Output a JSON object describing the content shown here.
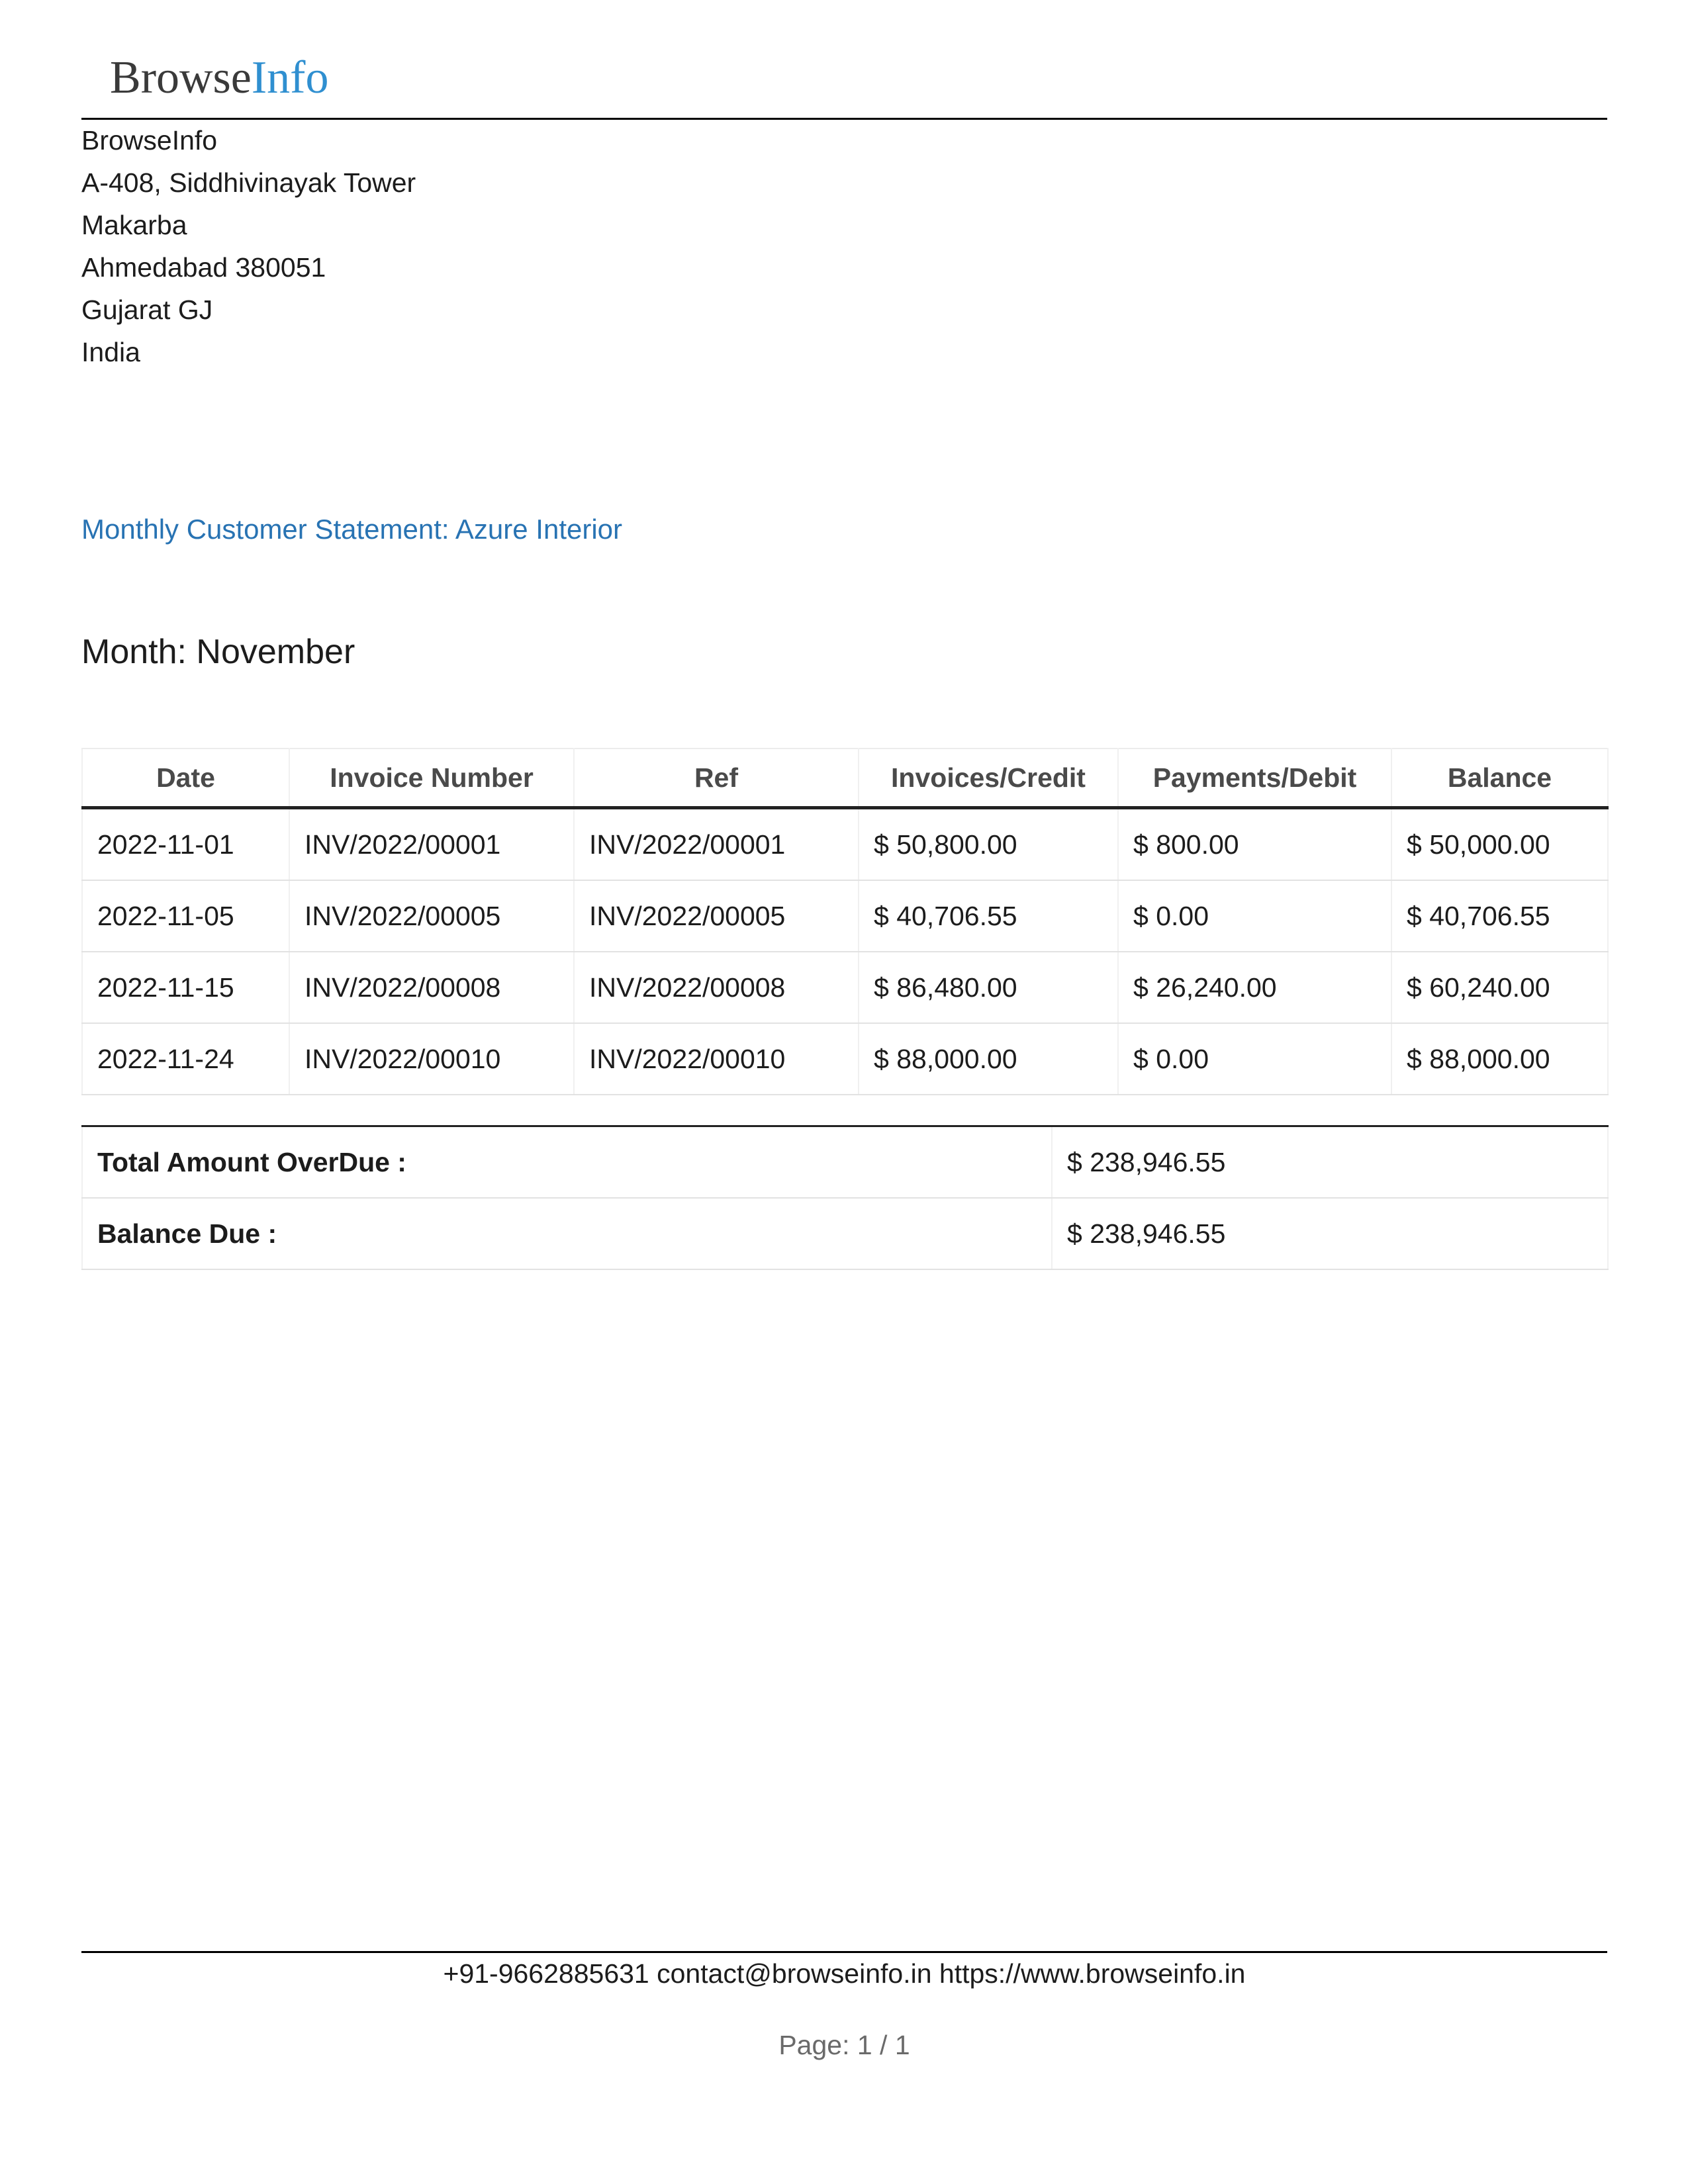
{
  "logo": {
    "part1": "Browse",
    "part2": "Info"
  },
  "company": {
    "lines": [
      "BrowseInfo",
      "A-408, Siddhivinayak Tower",
      "Makarba",
      "Ahmedabad 380051",
      "Gujarat GJ",
      "India"
    ]
  },
  "statement": {
    "title": "Monthly Customer Statement: Azure Interior",
    "month": "Month: November"
  },
  "table": {
    "headers": [
      "Date",
      "Invoice Number",
      "Ref",
      "Invoices/Credit",
      "Payments/Debit",
      "Balance"
    ],
    "rows": [
      [
        "2022-11-01",
        "INV/2022/00001",
        "INV/2022/00001",
        "$ 50,800.00",
        "$ 800.00",
        "$ 50,000.00"
      ],
      [
        "2022-11-05",
        "INV/2022/00005",
        "INV/2022/00005",
        "$ 40,706.55",
        "$ 0.00",
        "$ 40,706.55"
      ],
      [
        "2022-11-15",
        "INV/2022/00008",
        "INV/2022/00008",
        "$ 86,480.00",
        "$ 26,240.00",
        "$ 60,240.00"
      ],
      [
        "2022-11-24",
        "INV/2022/00010",
        "INV/2022/00010",
        "$ 88,000.00",
        "$ 0.00",
        "$ 88,000.00"
      ]
    ]
  },
  "totals": {
    "overdue_label": "Total Amount OverDue :",
    "overdue_value": "$ 238,946.55",
    "balance_label": "Balance Due :",
    "balance_value": "$ 238,946.55"
  },
  "footer": {
    "contact": "+91-9662885631 contact@browseinfo.in https://www.browseinfo.in",
    "page": "Page: 1 / 1"
  },
  "colors": {
    "logo_accent": "#2f8fd0",
    "title_blue": "#2873b3"
  }
}
